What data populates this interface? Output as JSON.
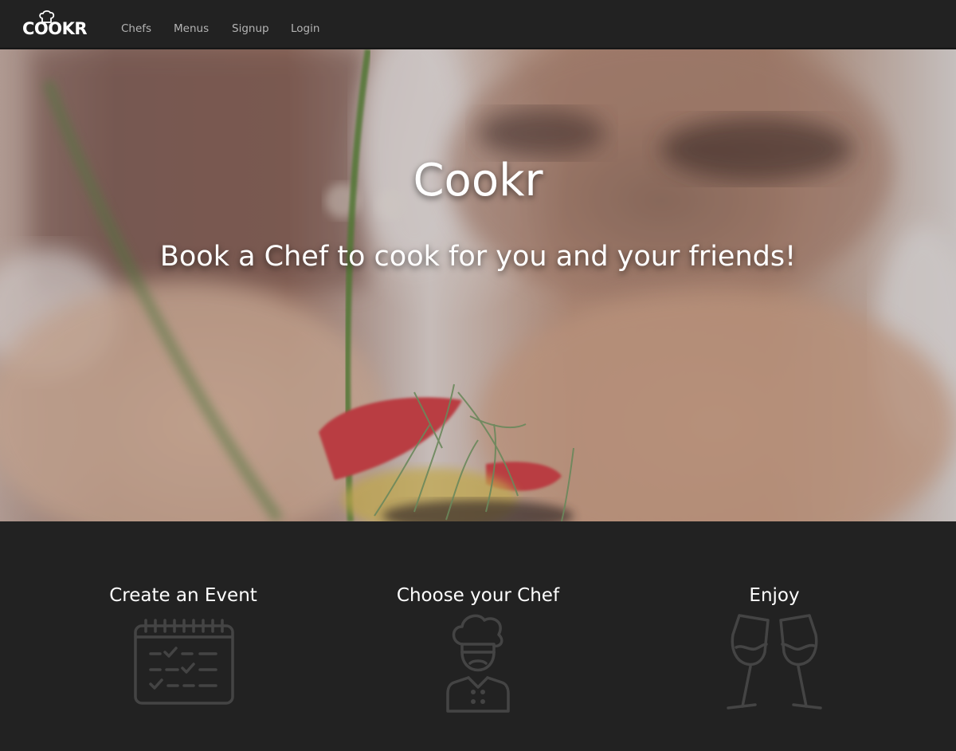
{
  "nav": {
    "brand": "COOKR",
    "links": [
      "Chefs",
      "Menus",
      "Signup",
      "Login"
    ]
  },
  "hero": {
    "title": "Cookr",
    "subtitle": "Book a Chef to cook for you and your friends!"
  },
  "steps": [
    {
      "title": "Create an Event",
      "icon": "calendar-icon"
    },
    {
      "title": "Choose your Chef",
      "icon": "chef-icon"
    },
    {
      "title": "Enjoy",
      "icon": "champagne-glasses-icon"
    }
  ],
  "colors": {
    "background": "#222222",
    "text": "#ffffff",
    "nav_link": "#b4b4b4",
    "icon_stroke": "#444444"
  }
}
